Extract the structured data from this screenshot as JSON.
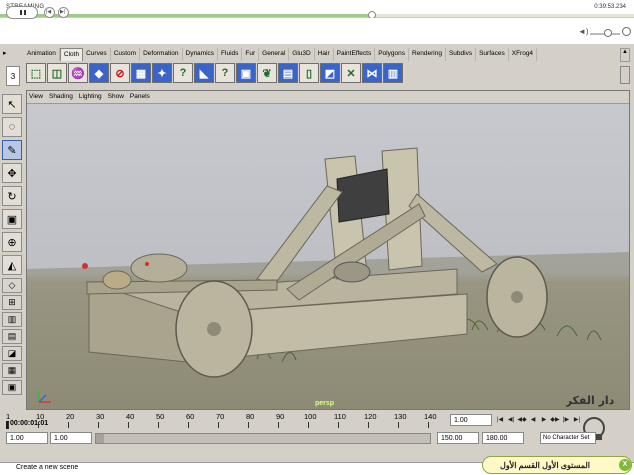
{
  "player": {
    "streaming_label": "STREAMING",
    "time": "0:39:53.234",
    "progress": 0.587
  },
  "shelf": {
    "tabs": [
      "Animation",
      "Cloth",
      "Curves",
      "Custom",
      "Deformation",
      "Dynamics",
      "Fluids",
      "Fur",
      "General",
      "Glu3D",
      "Hair",
      "PaintEffects",
      "Polygons",
      "Rendering",
      "Subdivs",
      "Surfaces",
      "XFrog4"
    ],
    "active_tab": "Cloth",
    "number": "3"
  },
  "panel_menu": [
    "View",
    "Shading",
    "Lighting",
    "Show",
    "Panels"
  ],
  "viewport": {
    "camera_label": "persp"
  },
  "timeline": {
    "ticks": [
      "1",
      "10",
      "20",
      "30",
      "40",
      "50",
      "60",
      "70",
      "80",
      "90",
      "100",
      "110",
      "120",
      "130",
      "140"
    ],
    "time_overlay": "00:00:01:01",
    "current_time": "1.00"
  },
  "range": {
    "start": "1.00",
    "anim_start": "1.00",
    "range_end": "150.00",
    "anim_end": "180.00",
    "character_set": "No Character Set"
  },
  "status": {
    "text": "Create a new scene"
  },
  "course": {
    "text": "المستوى الأول القسم الأول",
    "icon_letter": "X"
  },
  "watermark": {
    "text": "دار الفكر"
  },
  "colors": {
    "viewport_sky": "#c7c9cf",
    "ground": "#8e8a75",
    "stream_progress": "#9fcb87",
    "banner_bg": "#fff9c7",
    "banner_icon": "#7dbb3a"
  }
}
